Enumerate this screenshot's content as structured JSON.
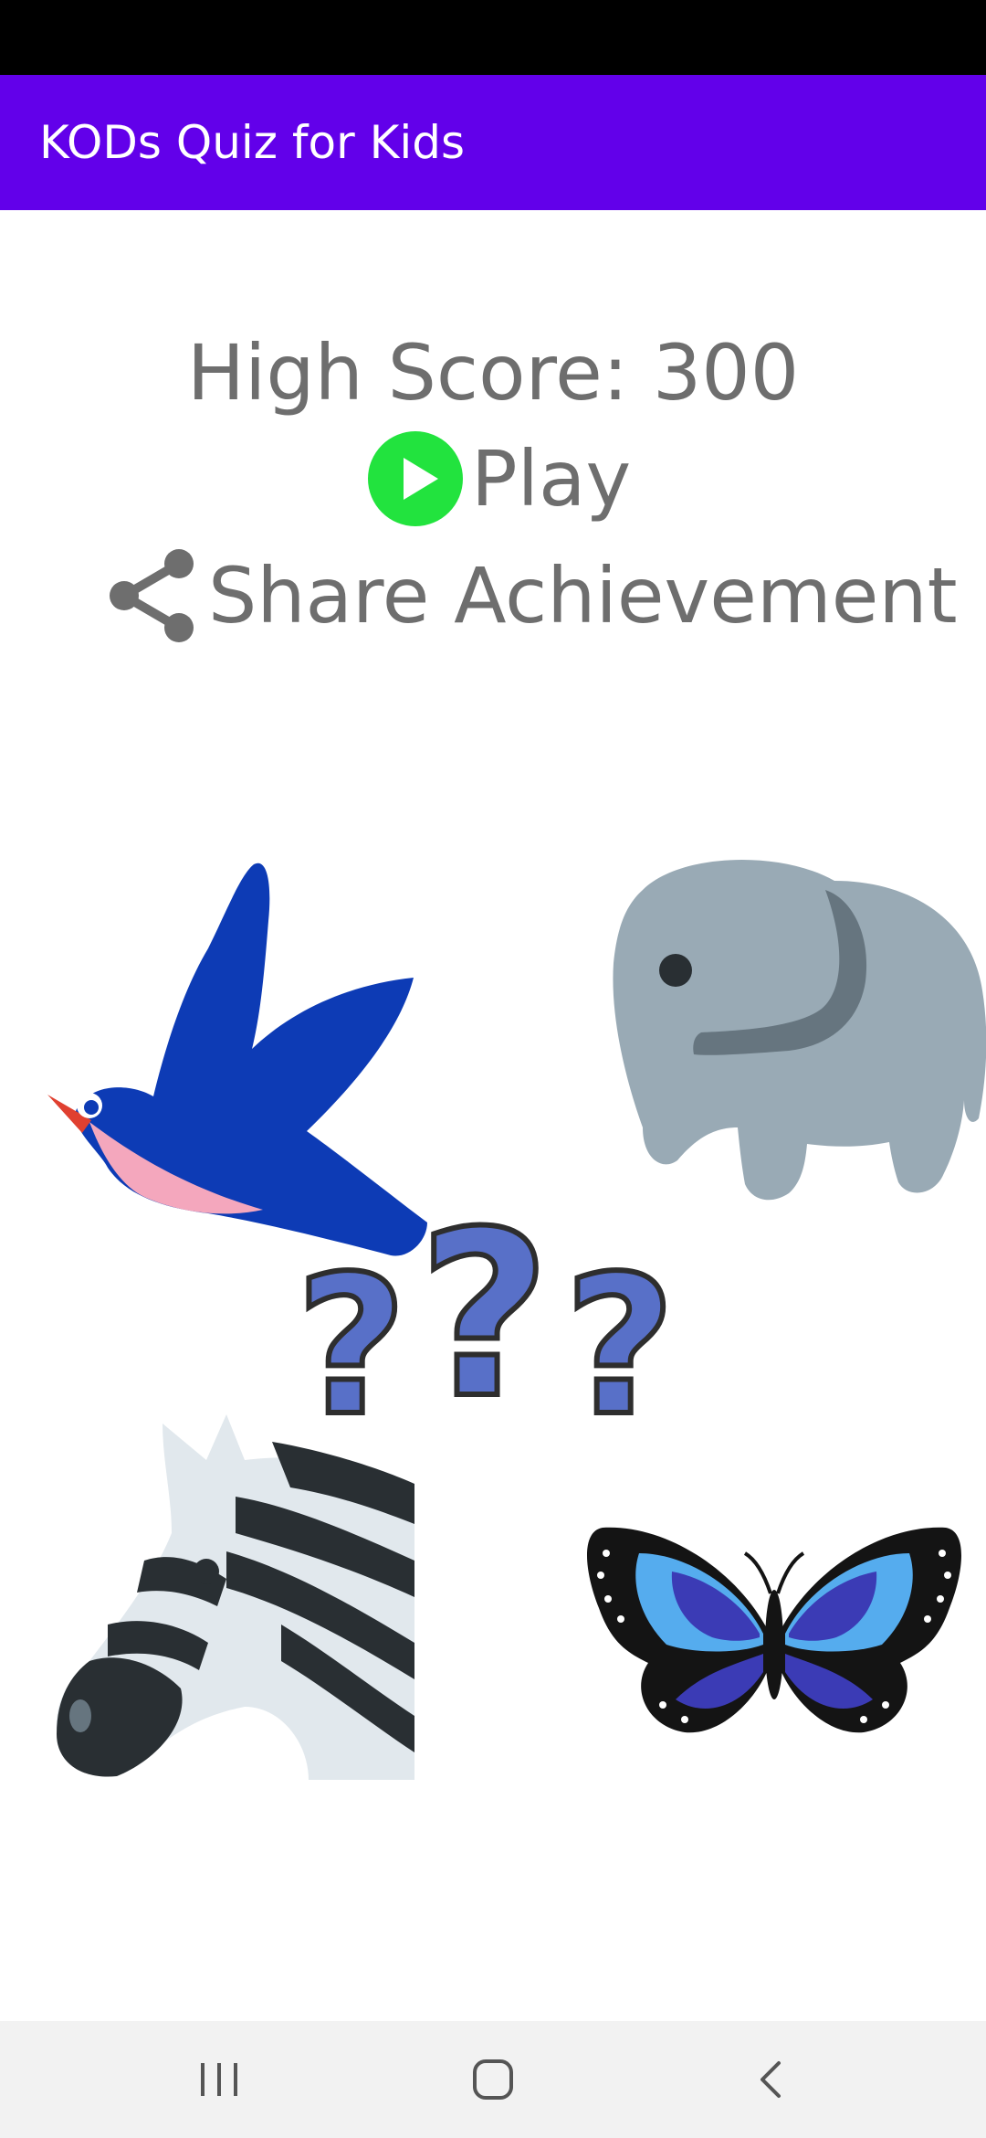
{
  "app_bar": {
    "title": "KODs Quiz for Kids"
  },
  "score": {
    "text": "High Score: 300",
    "value": 300
  },
  "actions": {
    "play_label": "Play",
    "play_icon": "play-circle-icon",
    "share_label": "Share Achievement",
    "share_icon": "share-icon"
  },
  "illustrations": [
    "bird",
    "elephant",
    "question-marks",
    "zebra",
    "butterfly"
  ],
  "nav": {
    "recents_icon": "recents-icon",
    "home_icon": "home-icon",
    "back_icon": "back-icon"
  },
  "colors": {
    "app_bar": "#6200ea",
    "status_bar": "#000000",
    "text_gray": "#6e6e6e",
    "play_green": "#22e33e",
    "nav_bar": "#f2f2f2"
  }
}
